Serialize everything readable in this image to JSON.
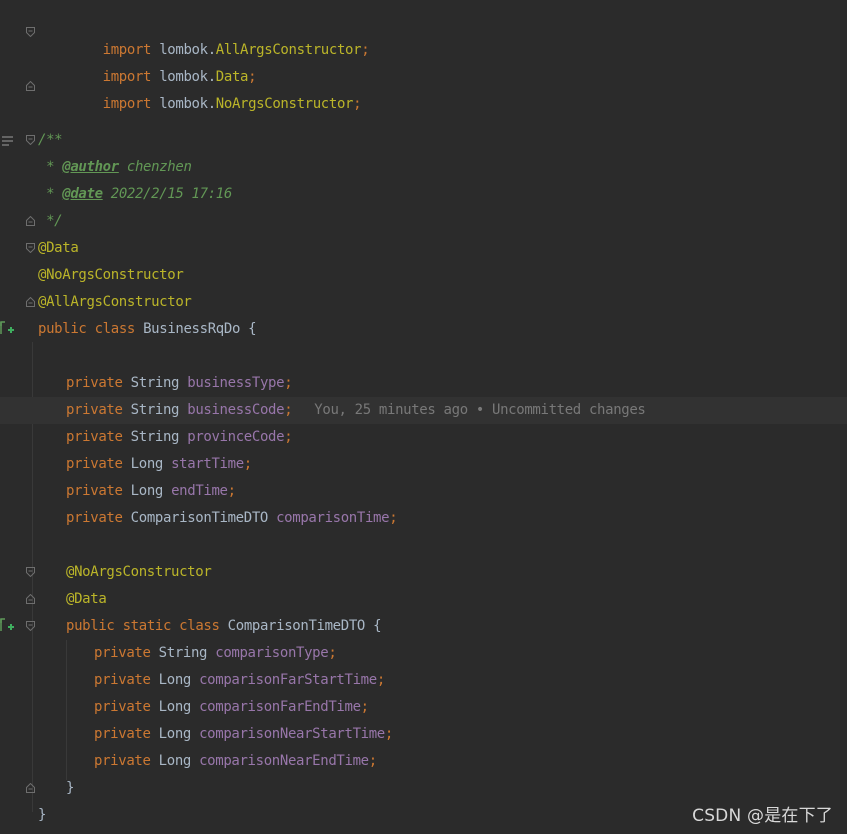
{
  "imports": [
    {
      "kw": "import",
      "pkg": "lombok.",
      "cls": "AllArgsConstructor",
      "end": ";"
    },
    {
      "kw": "import",
      "pkg": "lombok.",
      "cls": "Data",
      "end": ";"
    },
    {
      "kw": "import",
      "pkg": "lombok.",
      "cls": "NoArgsConstructor",
      "end": ";"
    }
  ],
  "javadoc": {
    "open": "/**",
    "star": " * ",
    "author_tag": "@author",
    "author_value": " chenzhen",
    "date_tag": "@date",
    "date_value": " 2022/2/15 17:16",
    "close": " */"
  },
  "class_annotations": [
    "@Data",
    "@NoArgsConstructor",
    "@AllArgsConstructor"
  ],
  "class_decl": {
    "kw1": "public",
    "kw2": "class",
    "name": "BusinessRqDo",
    "brace": " {"
  },
  "fields": [
    {
      "mod": "private",
      "type": "String",
      "name": "businessType"
    },
    {
      "mod": "private",
      "type": "String",
      "name": "businessCode"
    },
    {
      "mod": "private",
      "type": "String",
      "name": "provinceCode"
    },
    {
      "mod": "private",
      "type": "Long",
      "name": "startTime"
    },
    {
      "mod": "private",
      "type": "Long",
      "name": "endTime"
    },
    {
      "mod": "private",
      "type": "ComparisonTimeDTO",
      "name": "comparisonTime"
    }
  ],
  "blame": "You, 25 minutes ago • Uncommitted changes",
  "inner_annotations": [
    "@NoArgsConstructor",
    "@Data"
  ],
  "inner_decl": {
    "kw1": "public",
    "kw2": "static",
    "kw3": "class",
    "name": "ComparisonTimeDTO",
    "brace": " {"
  },
  "inner_fields": [
    {
      "mod": "private",
      "type": "String",
      "name": "comparisonType"
    },
    {
      "mod": "private",
      "type": "Long",
      "name": "comparisonFarStartTime"
    },
    {
      "mod": "private",
      "type": "Long",
      "name": "comparisonFarEndTime"
    },
    {
      "mod": "private",
      "type": "Long",
      "name": "comparisonNearStartTime"
    },
    {
      "mod": "private",
      "type": "Long",
      "name": "comparisonNearEndTime"
    }
  ],
  "inner_close": "}",
  "outer_close": "}",
  "semicolon": ";",
  "watermark": "CSDN @是在下了",
  "colors": {
    "background": "#2b2b2b",
    "keyword": "#cc7832",
    "annotation": "#bbb529",
    "field": "#9876aa",
    "comment": "#629755",
    "text": "#a9b7c6",
    "current_line": "#323232"
  }
}
